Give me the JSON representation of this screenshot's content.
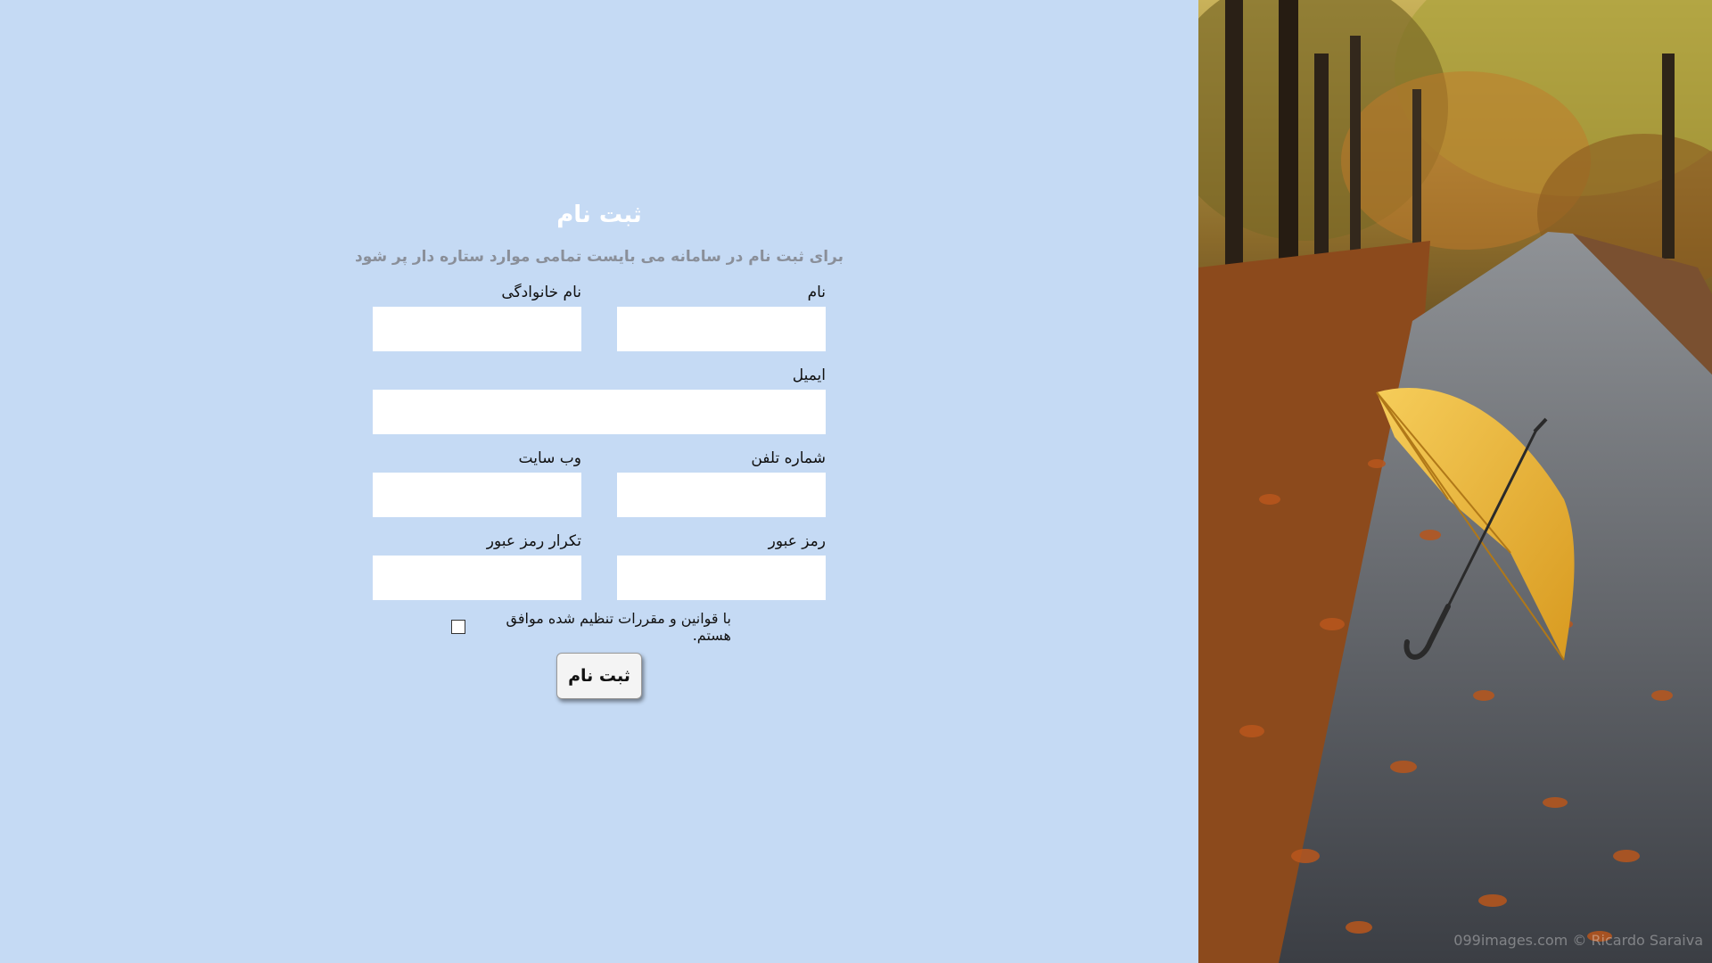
{
  "form": {
    "title": "ثبت نام",
    "subtitle": "برای ثبت نام در سامانه می بایست تمامی موارد ستاره دار پر شود",
    "fields": {
      "first_name": {
        "label": "نام",
        "value": "",
        "placeholder": ""
      },
      "last_name": {
        "label": "نام خانوادگی",
        "value": "",
        "placeholder": ""
      },
      "email": {
        "label": "ایمیل",
        "value": "",
        "placeholder": ""
      },
      "phone": {
        "label": "شماره تلفن",
        "value": "",
        "placeholder": ""
      },
      "website": {
        "label": "وب سایت",
        "value": "",
        "placeholder": ""
      },
      "password": {
        "label": "رمز عبور",
        "value": "",
        "placeholder": ""
      },
      "password_repeat": {
        "label": "تکرار رمز عبور",
        "value": "",
        "placeholder": ""
      }
    },
    "agree_label": "با قوانین و مقررات تنظیم شده موافق هستم.",
    "agree_checked": false,
    "submit_label": "ثبت نام"
  },
  "image": {
    "watermark": "099images.com © Ricardo Saraiva"
  },
  "colors": {
    "background": "#c5daf4",
    "input_background": "#ffffff",
    "title": "#ffffff",
    "subtitle": "#8a8f99"
  }
}
